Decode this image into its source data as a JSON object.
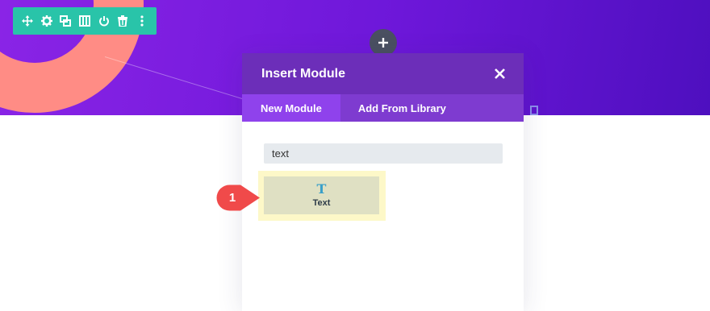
{
  "colors": {
    "hero_start": "#8a24e6",
    "hero_end": "#4e0fbf",
    "ring": "#ff8c85",
    "toolbar": "#29c4a9",
    "modal_header": "#6c2eb9",
    "tab_active": "#8f42ec",
    "tab_bar": "#7e3bd0",
    "callout": "#f04a4a",
    "highlight": "#fdf8c8"
  },
  "row_toolbar": {
    "icons": [
      "move-icon",
      "gear-icon",
      "duplicate-icon",
      "columns-icon",
      "power-icon",
      "trash-icon",
      "more-icon"
    ]
  },
  "modal": {
    "title": "Insert Module",
    "close_icon": "close-icon",
    "tabs": [
      {
        "label": "New Module",
        "active": true
      },
      {
        "label": "Add From Library",
        "active": false
      }
    ],
    "search": {
      "value": "text",
      "placeholder": ""
    },
    "modules": [
      {
        "label": "Text",
        "icon_glyph": "T",
        "icon": "text-module-icon"
      }
    ]
  },
  "callout": {
    "number": "1"
  }
}
